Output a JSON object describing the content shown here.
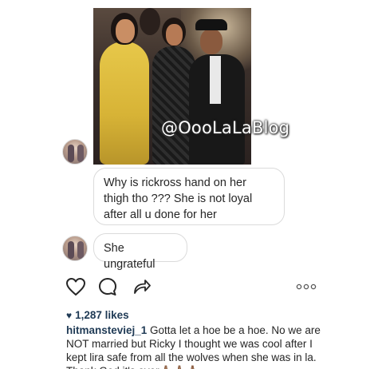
{
  "post": {
    "photo": {
      "watermark": "@OooLaLaBlog"
    },
    "comments": [
      {
        "text": "Why is rickross hand on her thigh tho ??? She is not loyal after all u done for her"
      },
      {
        "text": "She ungrateful"
      }
    ],
    "actions": {
      "like_icon": "heart-outline-icon",
      "comment_icon": "speech-bubble-icon",
      "share_icon": "share-arrow-icon",
      "more_icon": "ellipsis-icon"
    },
    "likes": {
      "icon": "heart-icon",
      "count": "1,287 likes"
    },
    "caption": {
      "username": "hitmansteviej_1",
      "text": " Gotta let a hoe be a hoe. No we are NOT married but Ricky I thought we was cool after I kept lira safe from all the wolves when she was in la. Thank God it's over🙏🏽🙏🏽🙏🏽"
    },
    "colors": {
      "link_blue": "#1f3a55",
      "text": "#262626",
      "border": "#dbdbdb"
    }
  }
}
